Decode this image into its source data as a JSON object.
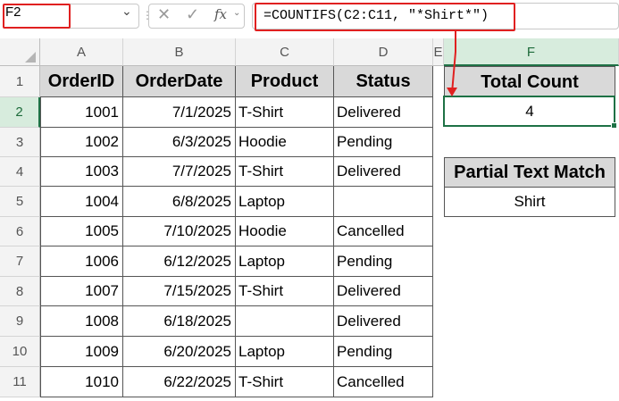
{
  "namebox": {
    "value": "F2"
  },
  "formula_bar": {
    "cancel_icon": "close-icon",
    "enter_icon": "check-icon",
    "function_icon": "fx-icon",
    "formula": "=COUNTIFS(C2:C11, \"*Shirt*\")"
  },
  "columns": [
    "A",
    "B",
    "C",
    "D",
    "E",
    "F"
  ],
  "rows": [
    "1",
    "2",
    "3",
    "4",
    "5",
    "6",
    "7",
    "8",
    "9",
    "10",
    "11"
  ],
  "selected_cell": {
    "column": "F",
    "row": "2"
  },
  "table": {
    "headers": [
      "OrderID",
      "OrderDate",
      "Product",
      "Status"
    ],
    "rows": [
      [
        "1001",
        "7/1/2025",
        "T-Shirt",
        "Delivered"
      ],
      [
        "1002",
        "6/3/2025",
        "Hoodie",
        "Pending"
      ],
      [
        "1003",
        "7/7/2025",
        "T-Shirt",
        "Delivered"
      ],
      [
        "1004",
        "6/8/2025",
        "Laptop",
        ""
      ],
      [
        "1005",
        "7/10/2025",
        "Hoodie",
        "Cancelled"
      ],
      [
        "1006",
        "6/12/2025",
        "Laptop",
        "Pending"
      ],
      [
        "1007",
        "7/15/2025",
        "T-Shirt",
        "Delivered"
      ],
      [
        "1008",
        "6/18/2025",
        "",
        "Delivered"
      ],
      [
        "1009",
        "6/20/2025",
        "Laptop",
        "Pending"
      ],
      [
        "1010",
        "6/22/2025",
        "T-Shirt",
        "Cancelled"
      ]
    ]
  },
  "total_count": {
    "header": "Total Count",
    "value": "4"
  },
  "partial_match": {
    "header": "Partial Text Match",
    "value": "Shirt"
  },
  "colors": {
    "highlight_red": "#e02020",
    "selection_green": "#1e7145",
    "header_fill": "#d9d9d9"
  }
}
